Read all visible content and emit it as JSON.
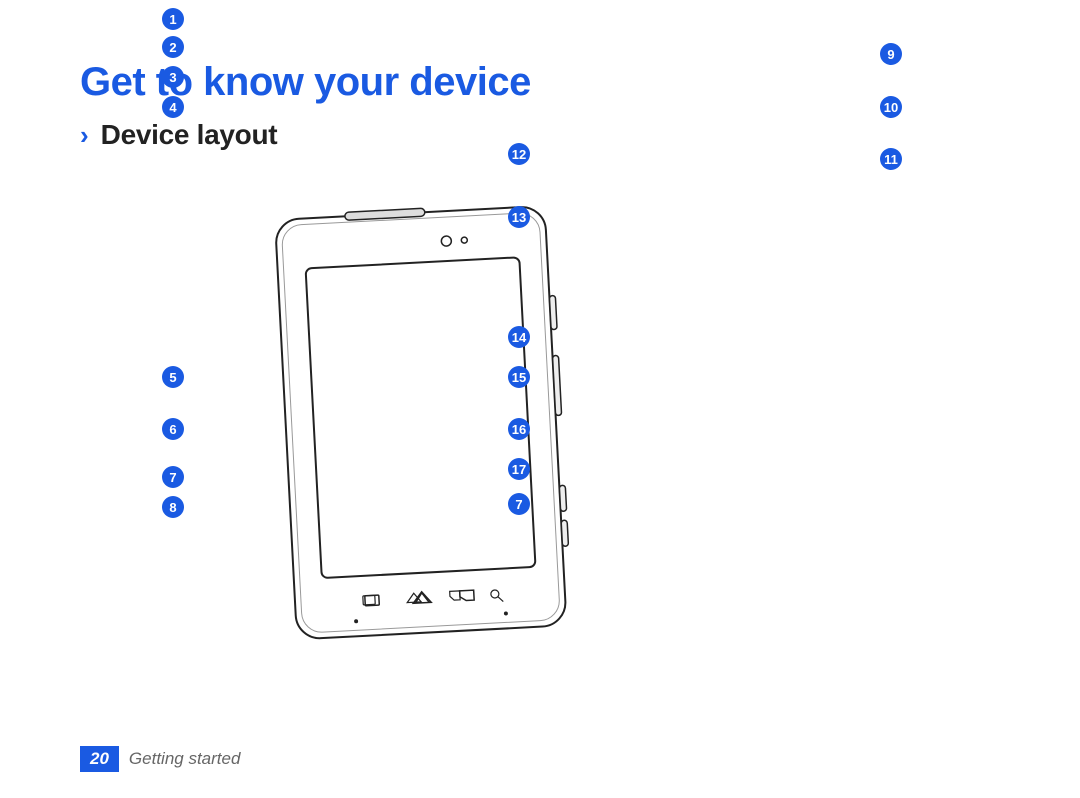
{
  "heading": "Get to know your device",
  "subheading": "Device layout",
  "page_number": "20",
  "section_label": "Getting started",
  "callouts": {
    "c1": "1",
    "c2": "2",
    "c3": "3",
    "c4": "4",
    "c5": "5",
    "c6": "6",
    "c7": "7",
    "c8": "8",
    "c9": "9",
    "c10": "10",
    "c11": "11",
    "c12": "12",
    "c13": "13",
    "c14": "14",
    "c15": "15",
    "c16": "16",
    "c17": "17",
    "c7b": "7"
  }
}
